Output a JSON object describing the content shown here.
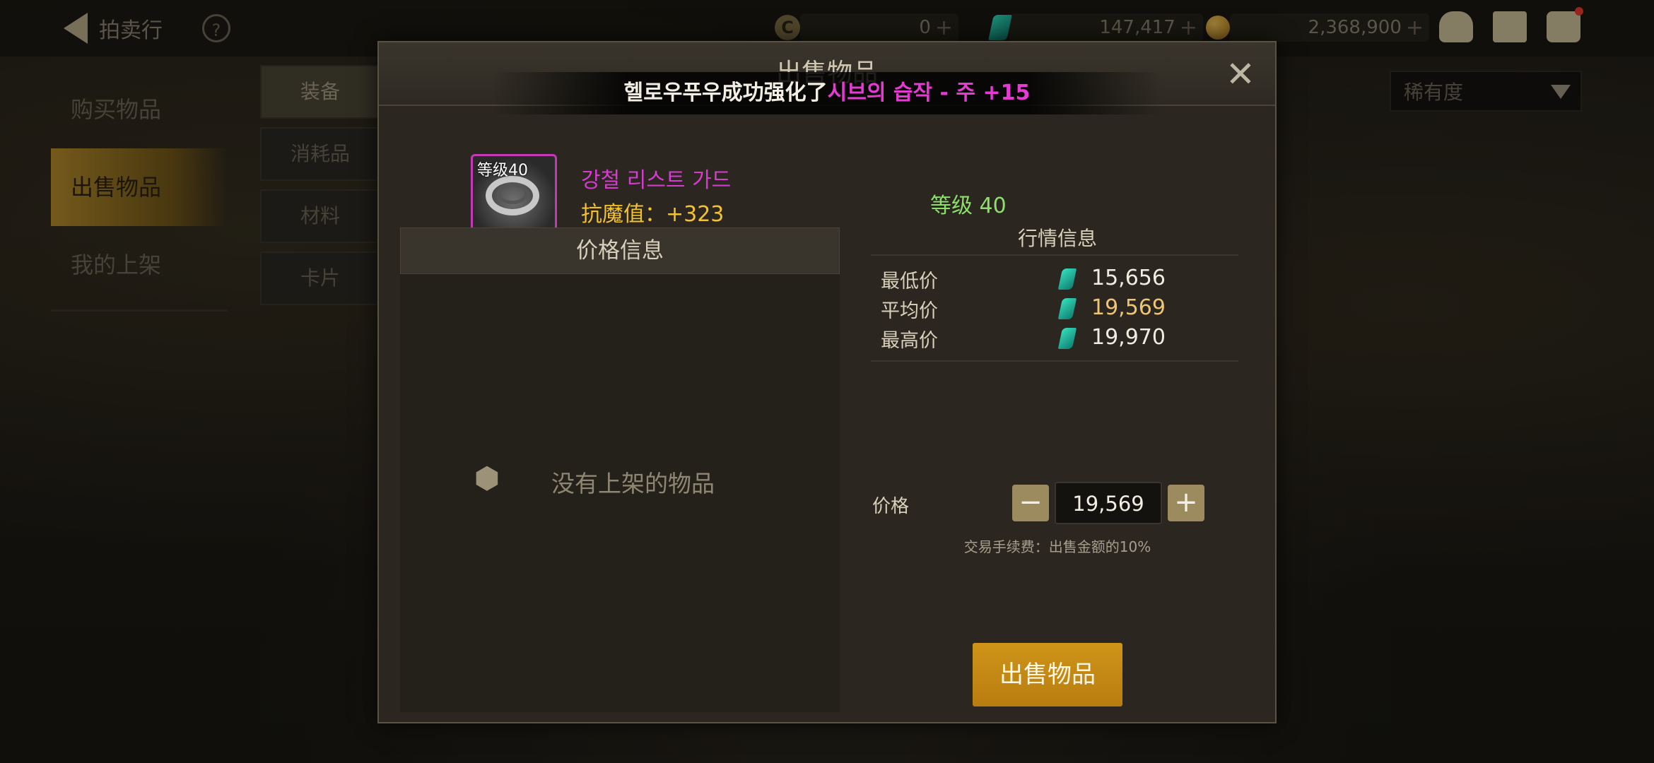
{
  "topbar": {
    "back_label": "拍卖行",
    "help_icon": "question-icon",
    "currency_c": "0",
    "currency_gem": "147,417",
    "currency_gold": "2,368,900"
  },
  "nav": {
    "items": [
      "购买物品",
      "出售物品",
      "我的上架"
    ],
    "active": 1
  },
  "sub_tabs": [
    "装备",
    "消耗品",
    "材料",
    "卡片"
  ],
  "rarity_select": "稀有度",
  "modal": {
    "title": "出售物品",
    "notice": {
      "prefix": "헬로우푸우成功强化了",
      "item": "시브의 습작 - 주 +15"
    },
    "item": {
      "level_badge": "等级40",
      "name": "강철 리스트 가드",
      "stat": "抗魔值：+323",
      "requirement": "等级 40"
    },
    "price_info": {
      "title": "价格信息",
      "empty_text": "没有上架的物品"
    },
    "market": {
      "title": "行情信息",
      "rows": [
        {
          "label": "最低价",
          "value": "15,656"
        },
        {
          "label": "平均价",
          "value": "19,569"
        },
        {
          "label": "最高价",
          "value": "19,970"
        }
      ]
    },
    "price": {
      "label": "价格",
      "value": "19,569",
      "minus": "−",
      "plus": "+"
    },
    "fee_text": "交易手续费：出售金额的10%",
    "sell_button": "出售物品"
  },
  "colors": {
    "accent_gold": "#c58a14",
    "item_name": "#d63bd0",
    "stat": "#f2c233",
    "level": "#8be06a"
  }
}
